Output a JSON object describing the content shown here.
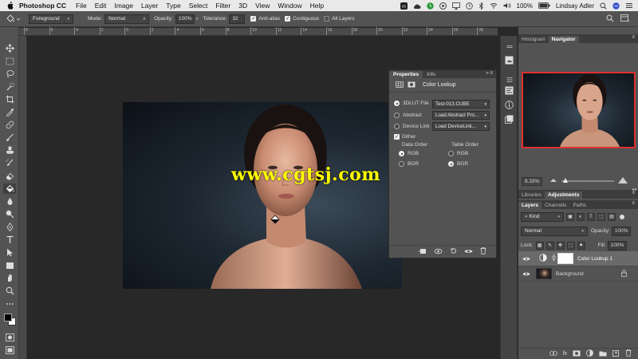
{
  "menubar": {
    "app_name": "Photoshop CC",
    "items": [
      "File",
      "Edit",
      "Image",
      "Layer",
      "Type",
      "Select",
      "Filter",
      "3D",
      "View",
      "Window",
      "Help"
    ],
    "battery": "100%",
    "user": "Lindsay Adler"
  },
  "options": {
    "fill_source": "Foreground",
    "mode_label": "Mode:",
    "mode_value": "Normal",
    "opacity_label": "Opacity:",
    "opacity_value": "100%",
    "tolerance_label": "Tolerance:",
    "tolerance_value": "32",
    "antialias_label": "Anti-alias",
    "contiguous_label": "Contiguous",
    "all_layers_label": "All Layers"
  },
  "ruler": {
    "ticks": [
      "8",
      "6",
      "4",
      "2",
      "0",
      "2",
      "4",
      "6",
      "8",
      "10",
      "12",
      "14",
      "16",
      "18",
      "20",
      "22",
      "24",
      "26",
      "28"
    ]
  },
  "watermark": "www.cgtsj.com",
  "properties": {
    "tabs": [
      "Properties",
      "Info"
    ],
    "header": "Color Lookup",
    "rows": [
      {
        "label": "3DLUT File",
        "value": "Test-013.CUBE"
      },
      {
        "label": "Abstract",
        "value": "Load Abstract Pro..."
      },
      {
        "label": "Device Link",
        "value": "Load DeviceLink..."
      }
    ],
    "dither_label": "Dither",
    "data_order_title": "Data Order",
    "table_order_title": "Table Order",
    "rgb": "RGB",
    "bgr": "BGR"
  },
  "panels": {
    "top_tabs": [
      "Histogram",
      "Navigator"
    ],
    "zoom_value": "8.33%",
    "mid_tabs": [
      "Libraries",
      "Adjustments"
    ],
    "layer_tabs": [
      "Layers",
      "Channels",
      "Paths"
    ],
    "kind_label": "Kind",
    "blend_mode": "Normal",
    "opacity_label": "Opacity:",
    "opacity_value": "100%",
    "lock_label": "Lock:",
    "fill_label": "Fill:",
    "fill_value": "100%",
    "layers": [
      {
        "name": "Color Lookup 1"
      },
      {
        "name": "Background"
      }
    ]
  }
}
